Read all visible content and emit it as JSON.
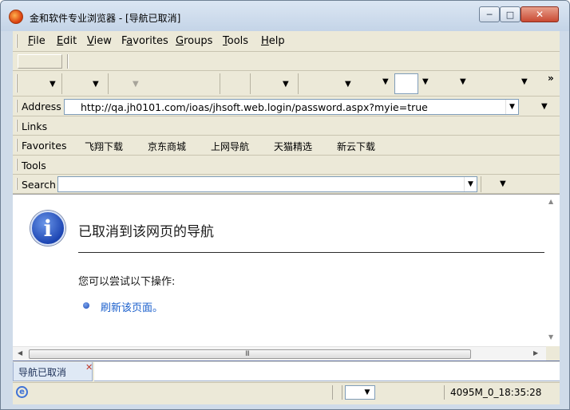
{
  "window": {
    "title": "金和软件专业浏览器 - [导航已取消]",
    "minimize": "─",
    "maximize": "□",
    "close": "✕"
  },
  "menu": {
    "items": [
      {
        "prefix": "",
        "key": "F",
        "rest": "ile"
      },
      {
        "prefix": "",
        "key": "E",
        "rest": "dit"
      },
      {
        "prefix": "",
        "key": "V",
        "rest": "iew"
      },
      {
        "prefix": "F",
        "key": "a",
        "rest": "vorites"
      },
      {
        "prefix": "",
        "key": "G",
        "rest": "roups"
      },
      {
        "prefix": "",
        "key": "T",
        "rest": "ools"
      },
      {
        "prefix": "",
        "key": "H",
        "rest": "elp"
      }
    ]
  },
  "toolbar": {
    "dropdown_arrow": "▼",
    "chevron": "»"
  },
  "address": {
    "label": "Address",
    "url": "http://qa.jh0101.com/ioas/jhsoft.web.login/password.aspx?myie=true"
  },
  "links": {
    "label": "Links"
  },
  "favorites": {
    "label": "Favorites",
    "items": [
      "飞翔下载",
      "京东商城",
      "上网导航",
      "天猫精选",
      "新云下载"
    ]
  },
  "tools": {
    "label": "Tools"
  },
  "search": {
    "label": "Search",
    "value": ""
  },
  "page": {
    "icon_glyph": "i",
    "title": "已取消到该网页的导航",
    "subtitle": "您可以尝试以下操作:",
    "action_link": "刷新该页面。"
  },
  "scroll": {
    "up": "▲",
    "down": "▼",
    "left": "◀",
    "right": "▶",
    "grip": "III"
  },
  "tab": {
    "label": "导航已取消",
    "close": "✕"
  },
  "status": {
    "icon_glyph": "e",
    "text": "4095M_0_18:35:28"
  }
}
